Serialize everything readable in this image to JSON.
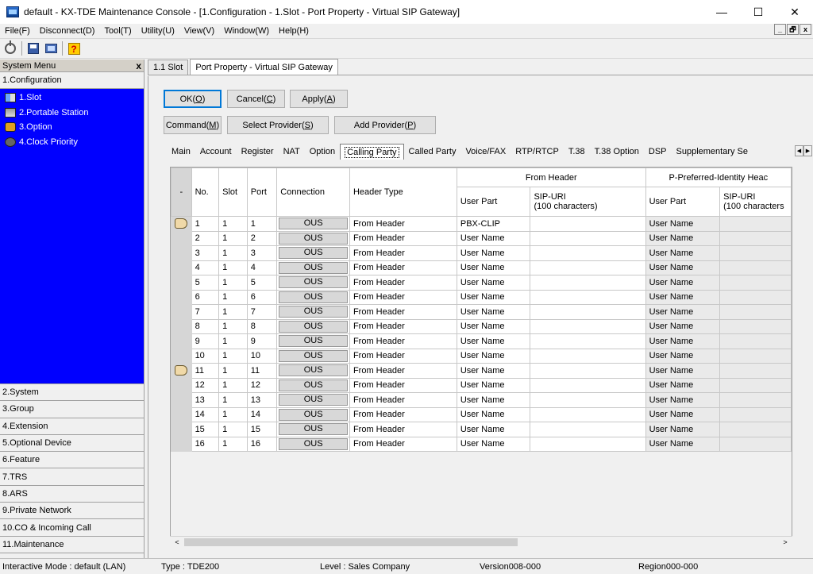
{
  "window": {
    "title": "default - KX-TDE Maintenance Console - [1.Configuration - 1.Slot - Port Property - Virtual SIP Gateway]",
    "minimize": "—",
    "maximize": "☐",
    "close": "✕"
  },
  "menubar": {
    "items": [
      "File(F)",
      "Disconnect(D)",
      "Tool(T)",
      "Utility(U)",
      "View(V)",
      "Window(W)",
      "Help(H)"
    ],
    "mdi": [
      "_",
      "🗗",
      "x"
    ]
  },
  "toolbar": {
    "icons": [
      "plug-icon",
      "save-icon",
      "monitor-icon",
      "help-icon"
    ],
    "help_glyph": "?"
  },
  "system_menu": {
    "header": "System Menu",
    "close": "x",
    "open_section": "1.Configuration",
    "tree": [
      {
        "label": "1.Slot",
        "icon": "slot-icon"
      },
      {
        "label": "2.Portable Station",
        "icon": "portable-station-icon"
      },
      {
        "label": "3.Option",
        "icon": "option-icon"
      },
      {
        "label": "4.Clock Priority",
        "icon": "clock-priority-icon"
      }
    ],
    "sections": [
      "2.System",
      "3.Group",
      "4.Extension",
      "5.Optional Device",
      "6.Feature",
      "7.TRS",
      "8.ARS",
      "9.Private Network",
      "10.CO & Incoming Call",
      "11.Maintenance"
    ]
  },
  "doc_tabs": [
    "1.1 Slot",
    "Port Property - Virtual SIP Gateway"
  ],
  "buttons": {
    "ok": "OK",
    "ok_key": "O",
    "cancel": "Cancel",
    "cancel_key": "C",
    "apply": "Apply",
    "apply_key": "A",
    "command": "Command",
    "command_key": "M",
    "select_provider": "Select Provider",
    "select_provider_key": "S",
    "add_provider": "Add Provider",
    "add_provider_key": "P"
  },
  "prop_tabs": [
    "Main",
    "Account",
    "Register",
    "NAT",
    "Option",
    "Calling Party",
    "Called Party",
    "Voice/FAX",
    "RTP/RTCP",
    "T.38",
    "T.38 Option",
    "DSP",
    "Supplementary Se"
  ],
  "prop_tabs_active": 5,
  "grid": {
    "headers": {
      "sel": "-",
      "no": "No.",
      "slot": "Slot",
      "port": "Port",
      "connection": "Connection",
      "header_type": "Header Type",
      "from_header": "From Header",
      "ppi_header": "P-Preferred-Identity Heac",
      "user_part": "User Part",
      "sip_uri_1": "SIP-URI",
      "sip_uri_2": "(100 characters)",
      "ppi_user_part": "User Part",
      "ppi_sip_uri_1": "SIP-URI",
      "ppi_sip_uri_2": "(100 characters"
    },
    "rows": [
      {
        "no": "1",
        "slot": "1",
        "port": "1",
        "connection": "OUS",
        "header_type": "From Header",
        "user_part": "PBX-CLIP",
        "sip_uri": "",
        "ppi_user_part": "User Name",
        "ppi_sip_uri": "",
        "marker": true
      },
      {
        "no": "2",
        "slot": "1",
        "port": "2",
        "connection": "OUS",
        "header_type": "From Header",
        "user_part": "User Name",
        "sip_uri": "",
        "ppi_user_part": "User Name",
        "ppi_sip_uri": "",
        "marker": false
      },
      {
        "no": "3",
        "slot": "1",
        "port": "3",
        "connection": "OUS",
        "header_type": "From Header",
        "user_part": "User Name",
        "sip_uri": "",
        "ppi_user_part": "User Name",
        "ppi_sip_uri": "",
        "marker": false
      },
      {
        "no": "4",
        "slot": "1",
        "port": "4",
        "connection": "OUS",
        "header_type": "From Header",
        "user_part": "User Name",
        "sip_uri": "",
        "ppi_user_part": "User Name",
        "ppi_sip_uri": "",
        "marker": false
      },
      {
        "no": "5",
        "slot": "1",
        "port": "5",
        "connection": "OUS",
        "header_type": "From Header",
        "user_part": "User Name",
        "sip_uri": "",
        "ppi_user_part": "User Name",
        "ppi_sip_uri": "",
        "marker": false
      },
      {
        "no": "6",
        "slot": "1",
        "port": "6",
        "connection": "OUS",
        "header_type": "From Header",
        "user_part": "User Name",
        "sip_uri": "",
        "ppi_user_part": "User Name",
        "ppi_sip_uri": "",
        "marker": false
      },
      {
        "no": "7",
        "slot": "1",
        "port": "7",
        "connection": "OUS",
        "header_type": "From Header",
        "user_part": "User Name",
        "sip_uri": "",
        "ppi_user_part": "User Name",
        "ppi_sip_uri": "",
        "marker": false
      },
      {
        "no": "8",
        "slot": "1",
        "port": "8",
        "connection": "OUS",
        "header_type": "From Header",
        "user_part": "User Name",
        "sip_uri": "",
        "ppi_user_part": "User Name",
        "ppi_sip_uri": "",
        "marker": false
      },
      {
        "no": "9",
        "slot": "1",
        "port": "9",
        "connection": "OUS",
        "header_type": "From Header",
        "user_part": "User Name",
        "sip_uri": "",
        "ppi_user_part": "User Name",
        "ppi_sip_uri": "",
        "marker": false
      },
      {
        "no": "10",
        "slot": "1",
        "port": "10",
        "connection": "OUS",
        "header_type": "From Header",
        "user_part": "User Name",
        "sip_uri": "",
        "ppi_user_part": "User Name",
        "ppi_sip_uri": "",
        "marker": false
      },
      {
        "no": "11",
        "slot": "1",
        "port": "11",
        "connection": "OUS",
        "header_type": "From Header",
        "user_part": "User Name",
        "sip_uri": "",
        "ppi_user_part": "User Name",
        "ppi_sip_uri": "",
        "marker": true
      },
      {
        "no": "12",
        "slot": "1",
        "port": "12",
        "connection": "OUS",
        "header_type": "From Header",
        "user_part": "User Name",
        "sip_uri": "",
        "ppi_user_part": "User Name",
        "ppi_sip_uri": "",
        "marker": false
      },
      {
        "no": "13",
        "slot": "1",
        "port": "13",
        "connection": "OUS",
        "header_type": "From Header",
        "user_part": "User Name",
        "sip_uri": "",
        "ppi_user_part": "User Name",
        "ppi_sip_uri": "",
        "marker": false
      },
      {
        "no": "14",
        "slot": "1",
        "port": "14",
        "connection": "OUS",
        "header_type": "From Header",
        "user_part": "User Name",
        "sip_uri": "",
        "ppi_user_part": "User Name",
        "ppi_sip_uri": "",
        "marker": false
      },
      {
        "no": "15",
        "slot": "1",
        "port": "15",
        "connection": "OUS",
        "header_type": "From Header",
        "user_part": "User Name",
        "sip_uri": "",
        "ppi_user_part": "User Name",
        "ppi_sip_uri": "",
        "marker": false
      },
      {
        "no": "16",
        "slot": "1",
        "port": "16",
        "connection": "OUS",
        "header_type": "From Header",
        "user_part": "User Name",
        "sip_uri": "",
        "ppi_user_part": "User Name",
        "ppi_sip_uri": "",
        "marker": false
      }
    ]
  },
  "scrollbar": {
    "left": "<",
    "right": ">"
  },
  "statusbar": {
    "mode": "Interactive Mode : default (LAN)",
    "type": "Type : TDE200",
    "level": "Level : Sales Company",
    "version": "Version008-000",
    "region": "Region000-000"
  },
  "colors": {
    "tree_bg": "#0000ff",
    "accent": "#0078d7"
  }
}
